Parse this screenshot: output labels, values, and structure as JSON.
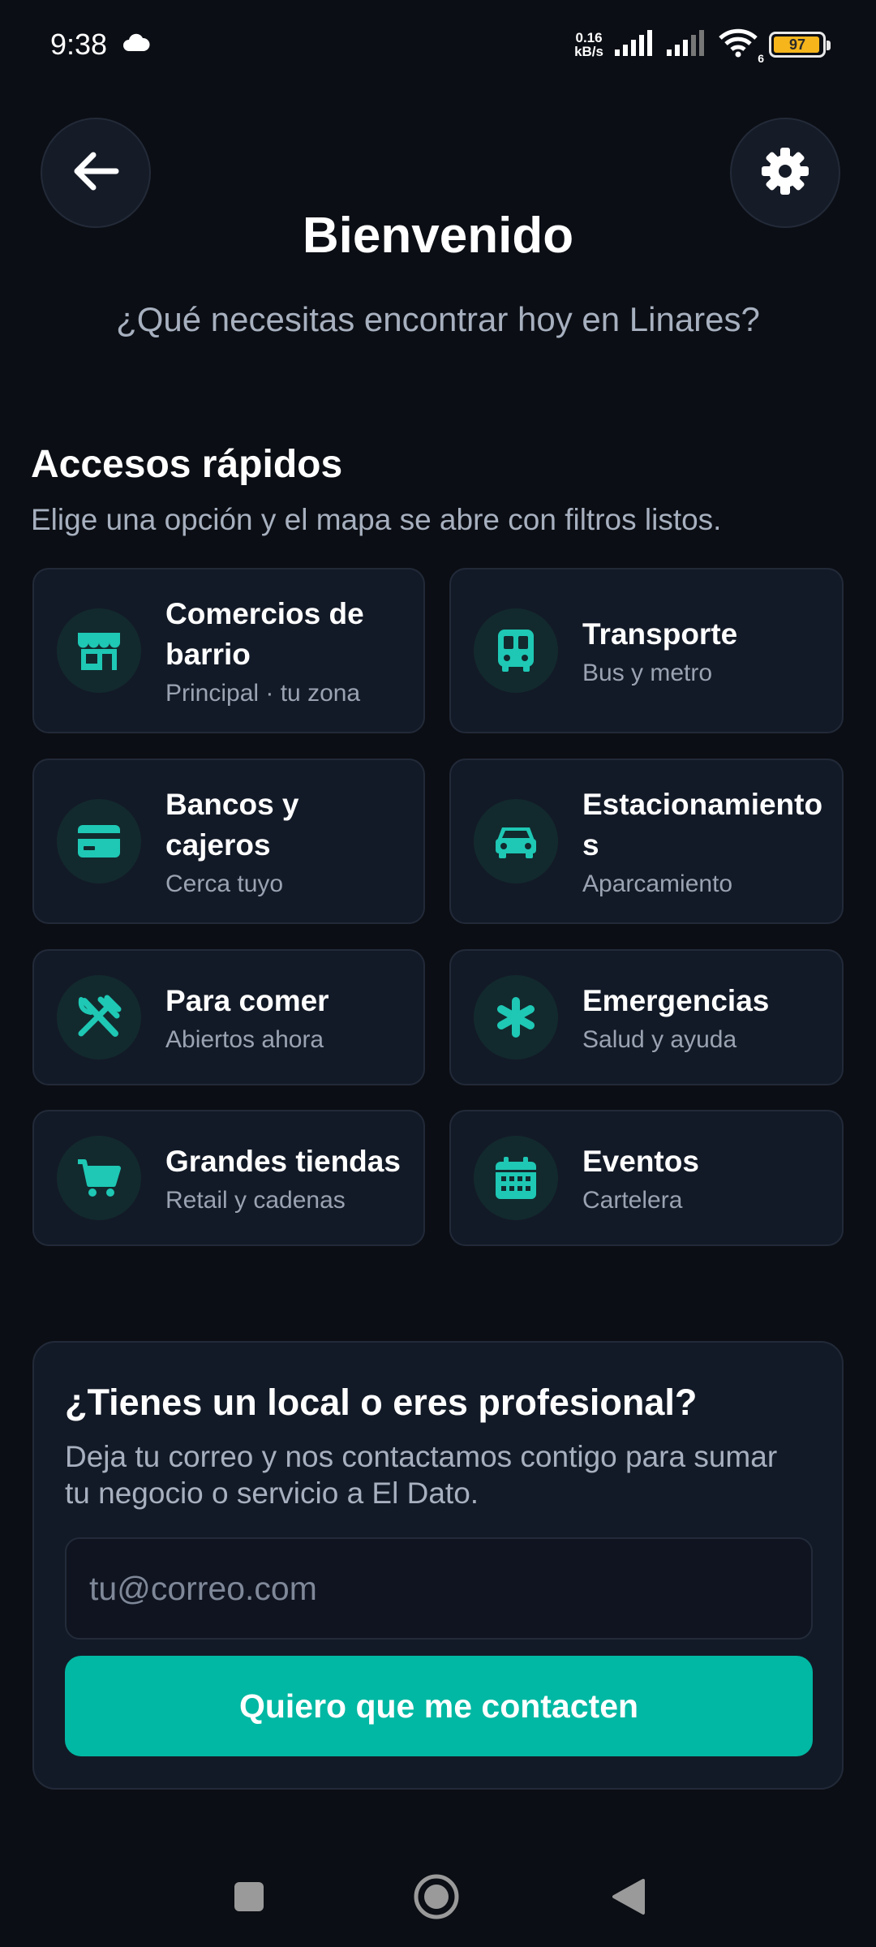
{
  "status_bar": {
    "time": "9:38",
    "net_speed_value": "0.16",
    "net_speed_unit": "kB/s",
    "wifi_badge": "6",
    "battery": "97"
  },
  "header": {
    "title": "Bienvenido",
    "subtitle": "¿Qué necesitas encontrar hoy en Linares?"
  },
  "quick_access": {
    "title": "Accesos rápidos",
    "subtitle": "Elige una opción y el mapa se abre con filtros listos.",
    "cards": [
      {
        "title": "Comercios de barrio",
        "sub": "Principal · tu zona",
        "icon": "store-icon"
      },
      {
        "title": "Transporte",
        "sub": "Bus y metro",
        "icon": "bus-icon"
      },
      {
        "title": "Bancos y cajeros",
        "sub": "Cerca tuyo",
        "icon": "credit-card-icon"
      },
      {
        "title": "Estacionamientos",
        "sub": "Aparcamiento",
        "icon": "car-icon"
      },
      {
        "title": "Para comer",
        "sub": "Abiertos ahora",
        "icon": "utensils-icon"
      },
      {
        "title": "Emergencias",
        "sub": "Salud y ayuda",
        "icon": "asterisk-icon"
      },
      {
        "title": "Grandes tiendas",
        "sub": "Retail y cadenas",
        "icon": "cart-icon"
      },
      {
        "title": "Eventos",
        "sub": "Cartelera",
        "icon": "calendar-icon"
      }
    ]
  },
  "contact": {
    "title": "¿Tienes un local o eres profesional?",
    "description": "Deja tu correo y nos contactamos contigo para sumar tu negocio o servicio a El Dato.",
    "email_placeholder": "tu@correo.com",
    "email_value": "",
    "button_label": "Quiero que me contacten"
  },
  "colors": {
    "background": "#0b0e14",
    "card": "#131a27",
    "accent": "#00b8a3",
    "icon_teal": "#1ec8b4"
  }
}
